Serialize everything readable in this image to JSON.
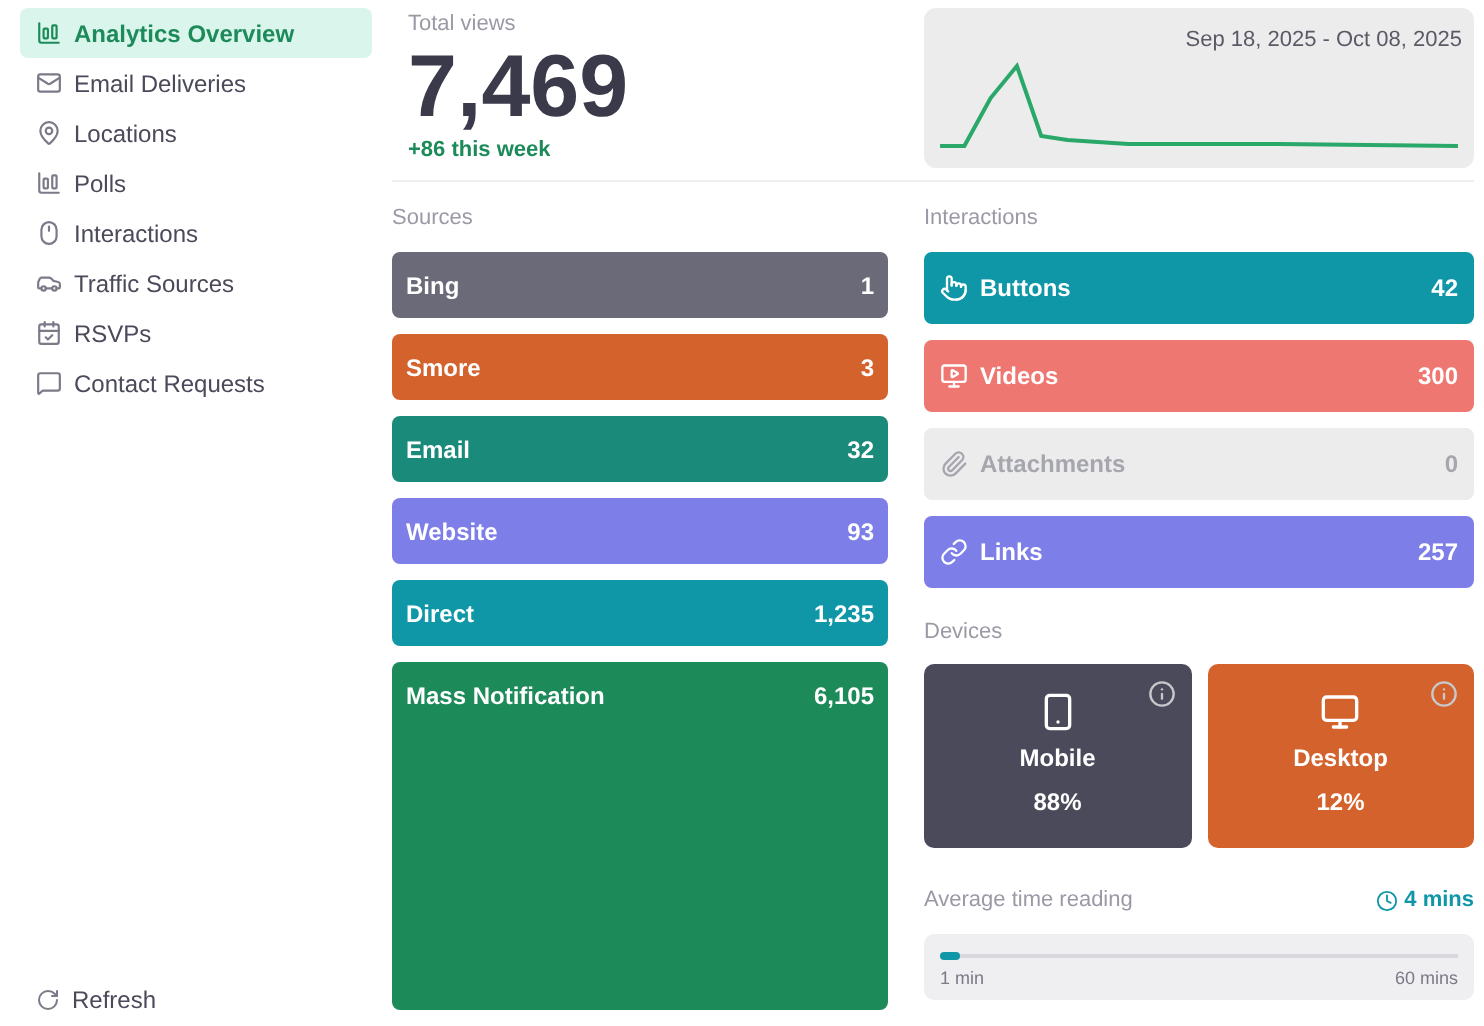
{
  "sidebar": {
    "items": [
      {
        "label": "Analytics Overview",
        "selected": true
      },
      {
        "label": "Email Deliveries",
        "selected": false
      },
      {
        "label": "Locations",
        "selected": false
      },
      {
        "label": "Polls",
        "selected": false
      },
      {
        "label": "Interactions",
        "selected": false
      },
      {
        "label": "Traffic Sources",
        "selected": false
      },
      {
        "label": "RSVPs",
        "selected": false
      },
      {
        "label": "Contact Requests",
        "selected": false
      }
    ],
    "refresh": "Refresh"
  },
  "summary": {
    "label": "Total views",
    "value": "7,469",
    "change": "+86 this week",
    "date_range": "Sep 18, 2025 - Oct 08, 2025"
  },
  "sources": {
    "title": "Sources",
    "items": [
      {
        "label": "Bing",
        "count": "1",
        "color": "#6b6a78"
      },
      {
        "label": "Smore",
        "count": "3",
        "color": "#d4622c"
      },
      {
        "label": "Email",
        "count": "32",
        "color": "#1a8a7a"
      },
      {
        "label": "Website",
        "count": "93",
        "color": "#7d7ee8"
      },
      {
        "label": "Direct",
        "count": "1,235",
        "color": "#0f97a8"
      },
      {
        "label": "Mass Notification",
        "count": "6,105",
        "color": "#1d8a5a"
      }
    ]
  },
  "interactions": {
    "title": "Interactions",
    "items": [
      {
        "label": "Buttons",
        "count": "42",
        "color": "#0f97a8",
        "disabled": false
      },
      {
        "label": "Videos",
        "count": "300",
        "color": "#ef7772",
        "disabled": false
      },
      {
        "label": "Attachments",
        "count": "0",
        "disabled": true
      },
      {
        "label": "Links",
        "count": "257",
        "color": "#7d7ee8",
        "disabled": false
      }
    ]
  },
  "devices": {
    "title": "Devices",
    "items": [
      {
        "label": "Mobile",
        "share": "88%",
        "color": "#4a4a5a"
      },
      {
        "label": "Desktop",
        "share": "12%",
        "color": "#d4622c"
      }
    ]
  },
  "reading": {
    "title": "Average time reading",
    "value": "4 mins",
    "level": 0.04,
    "min": "1 min",
    "max": "60 mins"
  }
}
